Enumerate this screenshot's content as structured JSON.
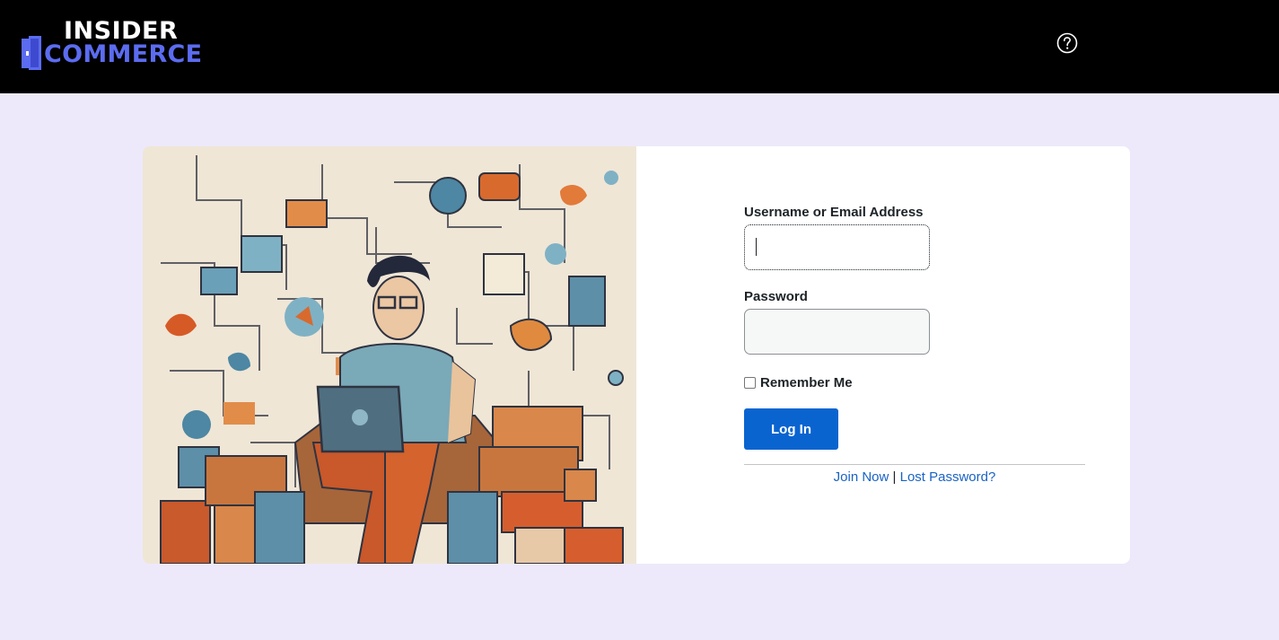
{
  "header": {
    "logo_line1": "INSIDER",
    "logo_line2": "COMMERCE",
    "help_icon": "question-circle-icon"
  },
  "login_form": {
    "username_label": "Username or Email Address",
    "username_value": "",
    "password_label": "Password",
    "password_value": "",
    "remember_label": "Remember Me",
    "remember_checked": false,
    "submit_label": "Log In",
    "join_link": "Join Now",
    "separator": "|",
    "lost_password_link": "Lost Password?"
  },
  "colors": {
    "header_bg": "#000000",
    "page_bg": "#ede9fb",
    "logo_accent": "#5b6cf0",
    "button_bg": "#0a64d0",
    "link": "#1a63c4"
  }
}
